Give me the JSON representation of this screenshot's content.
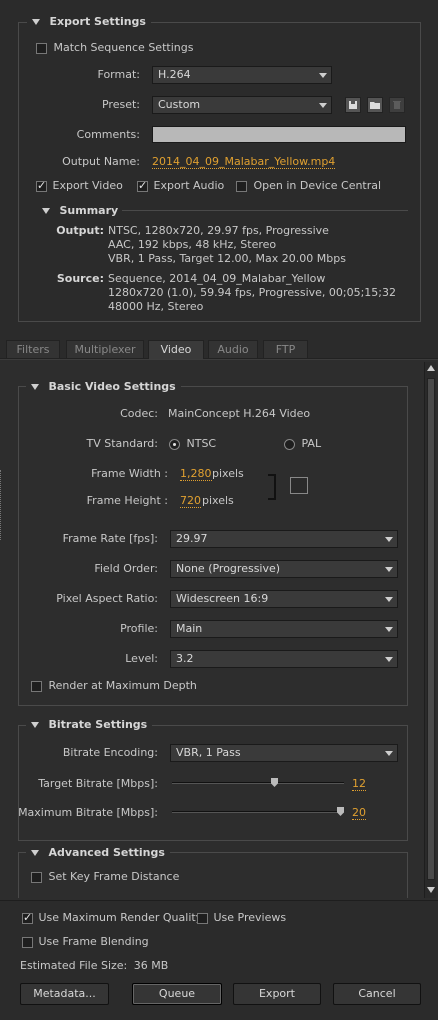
{
  "export_settings": {
    "header": "Export Settings",
    "match_sequence": "Match Sequence Settings",
    "format_label": "Format:",
    "format_value": "H.264",
    "preset_label": "Preset:",
    "preset_value": "Custom",
    "comments_label": "Comments:",
    "comments_value": "",
    "output_name_label": "Output Name:",
    "output_name_value": "2014_04_09_Malabar_Yellow.mp4",
    "export_video": "Export Video",
    "export_audio": "Export Audio",
    "device_central": "Open in Device Central"
  },
  "summary": {
    "header": "Summary",
    "output_label": "Output:",
    "output_lines": [
      "NTSC, 1280x720, 29.97 fps, Progressive",
      "AAC, 192 kbps, 48 kHz, Stereo",
      "VBR, 1 Pass, Target 12.00, Max 20.00 Mbps"
    ],
    "source_label": "Source:",
    "source_lines": [
      "Sequence, 2014_04_09_Malabar_Yellow",
      "1280x720 (1.0), 59.94 fps, Progressive, 00;05;15;32",
      "48000 Hz, Stereo"
    ]
  },
  "tabs": [
    "Filters",
    "Multiplexer",
    "Video",
    "Audio",
    "FTP"
  ],
  "basic_video": {
    "header": "Basic Video Settings",
    "codec_label": "Codec:",
    "codec_value": "MainConcept H.264 Video",
    "tv_standard_label": "TV Standard:",
    "ntsc": "NTSC",
    "pal": "PAL",
    "frame_width_label": "Frame Width :",
    "frame_width_value": "1,280",
    "frame_height_label": "Frame Height :",
    "frame_height_value": "720",
    "pixels": "pixels",
    "frame_rate_label": "Frame Rate [fps]:",
    "frame_rate_value": "29.97",
    "field_order_label": "Field Order:",
    "field_order_value": "None (Progressive)",
    "par_label": "Pixel Aspect Ratio:",
    "par_value": "Widescreen 16:9",
    "profile_label": "Profile:",
    "profile_value": "Main",
    "level_label": "Level:",
    "level_value": "3.2",
    "render_max_depth": "Render at Maximum Depth"
  },
  "bitrate": {
    "header": "Bitrate Settings",
    "encoding_label": "Bitrate Encoding:",
    "encoding_value": "VBR, 1 Pass",
    "target_label": "Target Bitrate [Mbps]:",
    "target_value": "12",
    "target_fraction": 0.6,
    "max_label": "Maximum Bitrate [Mbps]:",
    "max_value": "20",
    "max_fraction": 1.0
  },
  "advanced": {
    "header": "Advanced Settings",
    "key_frame": "Set Key Frame Distance"
  },
  "footer": {
    "max_render_quality": "Use Maximum Render Quality",
    "use_previews": "Use Previews",
    "frame_blending": "Use Frame Blending",
    "est_file_size_label": "Estimated File Size:",
    "est_file_size_value": "36 MB",
    "metadata_btn": "Metadata...",
    "queue_btn": "Queue",
    "export_btn": "Export",
    "cancel_btn": "Cancel"
  }
}
